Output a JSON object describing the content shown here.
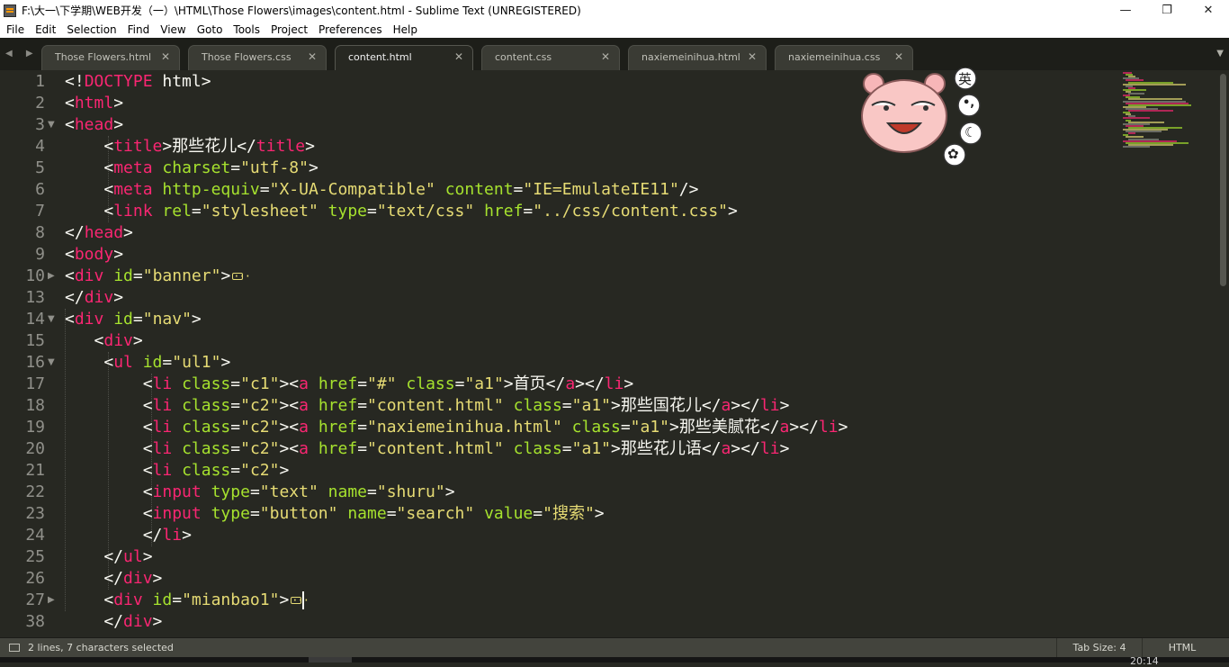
{
  "window": {
    "title": "F:\\大一\\下学期\\WEB开发（一）\\HTML\\Those Flowers\\images\\content.html - Sublime Text (UNREGISTERED)",
    "controls": {
      "minimize": "—",
      "maximize": "❐",
      "close": "✕"
    }
  },
  "menu": [
    "File",
    "Edit",
    "Selection",
    "Find",
    "View",
    "Goto",
    "Tools",
    "Project",
    "Preferences",
    "Help"
  ],
  "tabs": [
    {
      "label": "Those Flowers.html",
      "active": false
    },
    {
      "label": "Those Flowers.css",
      "active": false
    },
    {
      "label": "content.html",
      "active": true
    },
    {
      "label": "content.css",
      "active": false
    },
    {
      "label": "naxiemeinihua.html",
      "active": false
    },
    {
      "label": "naxiemeinihua.css",
      "active": false
    }
  ],
  "tab_nav": {
    "arrows": "◀ ▶",
    "menu": "▼",
    "close_glyph": "✕"
  },
  "editor": {
    "lines": [
      {
        "num": "1",
        "fold": "",
        "tokens": [
          [
            "p",
            "<!"
          ],
          [
            "t",
            "DOCTYPE"
          ],
          [
            "p",
            " html>"
          ]
        ]
      },
      {
        "num": "2",
        "fold": "",
        "tokens": [
          [
            "p",
            "<"
          ],
          [
            "t",
            "html"
          ],
          [
            "p",
            ">"
          ]
        ]
      },
      {
        "num": "3",
        "fold": "▼",
        "tokens": [
          [
            "p",
            "<"
          ],
          [
            "t",
            "head"
          ],
          [
            "p",
            ">"
          ]
        ]
      },
      {
        "num": "4",
        "fold": "",
        "tokens": [
          [
            "p",
            "    <"
          ],
          [
            "t",
            "title"
          ],
          [
            "p",
            ">那些花儿</"
          ],
          [
            "t",
            "title"
          ],
          [
            "p",
            ">"
          ]
        ]
      },
      {
        "num": "5",
        "fold": "",
        "tokens": [
          [
            "p",
            "    <"
          ],
          [
            "t",
            "meta"
          ],
          [
            "p",
            " "
          ],
          [
            "a",
            "charset"
          ],
          [
            "p",
            "="
          ],
          [
            "s",
            "\"utf-8\""
          ],
          [
            "p",
            ">"
          ]
        ]
      },
      {
        "num": "6",
        "fold": "",
        "tokens": [
          [
            "p",
            "    <"
          ],
          [
            "t",
            "meta"
          ],
          [
            "p",
            " "
          ],
          [
            "a",
            "http-equiv"
          ],
          [
            "p",
            "="
          ],
          [
            "s",
            "\"X-UA-Compatible\""
          ],
          [
            "p",
            " "
          ],
          [
            "a",
            "content"
          ],
          [
            "p",
            "="
          ],
          [
            "s",
            "\"IE=EmulateIE11\""
          ],
          [
            "p",
            "/>"
          ]
        ]
      },
      {
        "num": "7",
        "fold": "",
        "tokens": [
          [
            "p",
            "    <"
          ],
          [
            "t",
            "link"
          ],
          [
            "p",
            " "
          ],
          [
            "a",
            "rel"
          ],
          [
            "p",
            "="
          ],
          [
            "s",
            "\"stylesheet\""
          ],
          [
            "p",
            " "
          ],
          [
            "a",
            "type"
          ],
          [
            "p",
            "="
          ],
          [
            "s",
            "\"text/css\""
          ],
          [
            "p",
            " "
          ],
          [
            "a",
            "href"
          ],
          [
            "p",
            "="
          ],
          [
            "s",
            "\"../css/content.css\""
          ],
          [
            "p",
            ">"
          ]
        ]
      },
      {
        "num": "8",
        "fold": "",
        "tokens": [
          [
            "p",
            "</"
          ],
          [
            "t",
            "head"
          ],
          [
            "p",
            ">"
          ]
        ]
      },
      {
        "num": "9",
        "fold": "",
        "tokens": [
          [
            "p",
            "<"
          ],
          [
            "t",
            "body"
          ],
          [
            "p",
            ">"
          ]
        ]
      },
      {
        "num": "10",
        "fold": "▶",
        "tokens": [
          [
            "p",
            "<"
          ],
          [
            "t",
            "div"
          ],
          [
            "p",
            " "
          ],
          [
            "a",
            "id"
          ],
          [
            "p",
            "="
          ],
          [
            "s",
            "\"banner\""
          ],
          [
            "p",
            ">"
          ],
          [
            "e",
            ""
          ]
        ]
      },
      {
        "num": "13",
        "fold": "",
        "tokens": [
          [
            "p",
            "</"
          ],
          [
            "t",
            "div"
          ],
          [
            "p",
            ">"
          ]
        ]
      },
      {
        "num": "14",
        "fold": "▼",
        "tokens": [
          [
            "p",
            "<"
          ],
          [
            "t",
            "div"
          ],
          [
            "p",
            " "
          ],
          [
            "a",
            "id"
          ],
          [
            "p",
            "="
          ],
          [
            "s",
            "\"nav\""
          ],
          [
            "p",
            ">"
          ]
        ]
      },
      {
        "num": "15",
        "fold": "",
        "tokens": [
          [
            "p",
            "   <"
          ],
          [
            "t",
            "div"
          ],
          [
            "p",
            ">"
          ]
        ]
      },
      {
        "num": "16",
        "fold": "▼",
        "tokens": [
          [
            "p",
            "    <"
          ],
          [
            "t",
            "ul"
          ],
          [
            "p",
            " "
          ],
          [
            "a",
            "id"
          ],
          [
            "p",
            "="
          ],
          [
            "s",
            "\"ul1\""
          ],
          [
            "p",
            ">"
          ]
        ]
      },
      {
        "num": "17",
        "fold": "",
        "tokens": [
          [
            "p",
            "        <"
          ],
          [
            "t",
            "li"
          ],
          [
            "p",
            " "
          ],
          [
            "a",
            "class"
          ],
          [
            "p",
            "="
          ],
          [
            "s",
            "\"c1\""
          ],
          [
            "p",
            "><"
          ],
          [
            "t",
            "a"
          ],
          [
            "p",
            " "
          ],
          [
            "a",
            "href"
          ],
          [
            "p",
            "="
          ],
          [
            "s",
            "\"#\""
          ],
          [
            "p",
            " "
          ],
          [
            "a",
            "class"
          ],
          [
            "p",
            "="
          ],
          [
            "s",
            "\"a1\""
          ],
          [
            "p",
            ">首页</"
          ],
          [
            "t",
            "a"
          ],
          [
            "p",
            "></"
          ],
          [
            "t",
            "li"
          ],
          [
            "p",
            ">"
          ]
        ]
      },
      {
        "num": "18",
        "fold": "",
        "tokens": [
          [
            "p",
            "        <"
          ],
          [
            "t",
            "li"
          ],
          [
            "p",
            " "
          ],
          [
            "a",
            "class"
          ],
          [
            "p",
            "="
          ],
          [
            "s",
            "\"c2\""
          ],
          [
            "p",
            "><"
          ],
          [
            "t",
            "a"
          ],
          [
            "p",
            " "
          ],
          [
            "a",
            "href"
          ],
          [
            "p",
            "="
          ],
          [
            "s",
            "\"content.html\""
          ],
          [
            "p",
            " "
          ],
          [
            "a",
            "class"
          ],
          [
            "p",
            "="
          ],
          [
            "s",
            "\"a1\""
          ],
          [
            "p",
            ">那些国花儿</"
          ],
          [
            "t",
            "a"
          ],
          [
            "p",
            "></"
          ],
          [
            "t",
            "li"
          ],
          [
            "p",
            ">"
          ]
        ]
      },
      {
        "num": "19",
        "fold": "",
        "tokens": [
          [
            "p",
            "        <"
          ],
          [
            "t",
            "li"
          ],
          [
            "p",
            " "
          ],
          [
            "a",
            "class"
          ],
          [
            "p",
            "="
          ],
          [
            "s",
            "\"c2\""
          ],
          [
            "p",
            "><"
          ],
          [
            "t",
            "a"
          ],
          [
            "p",
            " "
          ],
          [
            "a",
            "href"
          ],
          [
            "p",
            "="
          ],
          [
            "s",
            "\"naxiemeinihua.html\""
          ],
          [
            "p",
            " "
          ],
          [
            "a",
            "class"
          ],
          [
            "p",
            "="
          ],
          [
            "s",
            "\"a1\""
          ],
          [
            "p",
            ">那些美腻花</"
          ],
          [
            "t",
            "a"
          ],
          [
            "p",
            "></"
          ],
          [
            "t",
            "li"
          ],
          [
            "p",
            ">"
          ]
        ]
      },
      {
        "num": "20",
        "fold": "",
        "tokens": [
          [
            "p",
            "        <"
          ],
          [
            "t",
            "li"
          ],
          [
            "p",
            " "
          ],
          [
            "a",
            "class"
          ],
          [
            "p",
            "="
          ],
          [
            "s",
            "\"c2\""
          ],
          [
            "p",
            "><"
          ],
          [
            "t",
            "a"
          ],
          [
            "p",
            " "
          ],
          [
            "a",
            "href"
          ],
          [
            "p",
            "="
          ],
          [
            "s",
            "\"content.html\""
          ],
          [
            "p",
            " "
          ],
          [
            "a",
            "class"
          ],
          [
            "p",
            "="
          ],
          [
            "s",
            "\"a1\""
          ],
          [
            "p",
            ">那些花儿语</"
          ],
          [
            "t",
            "a"
          ],
          [
            "p",
            "></"
          ],
          [
            "t",
            "li"
          ],
          [
            "p",
            ">"
          ]
        ]
      },
      {
        "num": "21",
        "fold": "",
        "tokens": [
          [
            "p",
            "        <"
          ],
          [
            "t",
            "li"
          ],
          [
            "p",
            " "
          ],
          [
            "a",
            "class"
          ],
          [
            "p",
            "="
          ],
          [
            "s",
            "\"c2\""
          ],
          [
            "p",
            ">"
          ]
        ]
      },
      {
        "num": "22",
        "fold": "",
        "tokens": [
          [
            "p",
            "        <"
          ],
          [
            "t",
            "input"
          ],
          [
            "p",
            " "
          ],
          [
            "a",
            "type"
          ],
          [
            "p",
            "="
          ],
          [
            "s",
            "\"text\""
          ],
          [
            "p",
            " "
          ],
          [
            "a",
            "name"
          ],
          [
            "p",
            "="
          ],
          [
            "s",
            "\"shuru\""
          ],
          [
            "p",
            ">"
          ]
        ]
      },
      {
        "num": "23",
        "fold": "",
        "tokens": [
          [
            "p",
            "        <"
          ],
          [
            "t",
            "input"
          ],
          [
            "p",
            " "
          ],
          [
            "a",
            "type"
          ],
          [
            "p",
            "="
          ],
          [
            "s",
            "\"button\""
          ],
          [
            "p",
            " "
          ],
          [
            "a",
            "name"
          ],
          [
            "p",
            "="
          ],
          [
            "s",
            "\"search\""
          ],
          [
            "p",
            " "
          ],
          [
            "a",
            "value"
          ],
          [
            "p",
            "="
          ],
          [
            "s",
            "\"搜索\""
          ],
          [
            "p",
            ">"
          ]
        ]
      },
      {
        "num": "24",
        "fold": "",
        "tokens": [
          [
            "p",
            "        </"
          ],
          [
            "t",
            "li"
          ],
          [
            "p",
            ">"
          ]
        ]
      },
      {
        "num": "25",
        "fold": "",
        "tokens": [
          [
            "p",
            "    </"
          ],
          [
            "t",
            "ul"
          ],
          [
            "p",
            ">"
          ]
        ]
      },
      {
        "num": "26",
        "fold": "",
        "tokens": [
          [
            "p",
            "    </"
          ],
          [
            "t",
            "div"
          ],
          [
            "p",
            ">"
          ]
        ]
      },
      {
        "num": "27",
        "fold": "▶",
        "tokens": [
          [
            "p",
            "    <"
          ],
          [
            "t",
            "div"
          ],
          [
            "p",
            " "
          ],
          [
            "a",
            "id"
          ],
          [
            "p",
            "="
          ],
          [
            "s",
            "\"mianbao1\""
          ],
          [
            "p",
            ">"
          ],
          [
            "e",
            ""
          ],
          [
            "c",
            ""
          ]
        ]
      },
      {
        "num": "38",
        "fold": "",
        "tokens": [
          [
            "p",
            "    </"
          ],
          [
            "t",
            "div"
          ],
          [
            "p",
            ">"
          ]
        ]
      }
    ]
  },
  "ime": {
    "mode": "英",
    "punct": "•,",
    "moon": "☾",
    "skin": "✿"
  },
  "status": {
    "selection": "2 lines, 7 characters selected",
    "tab_size": "Tab Size: 4",
    "syntax": "HTML"
  },
  "taskbar": {
    "clock": "20:14"
  },
  "colors": {
    "background": "#272822",
    "tag": "#f92672",
    "attribute": "#a6e22e",
    "string": "#e6db74",
    "plain": "#f8f8f2"
  }
}
